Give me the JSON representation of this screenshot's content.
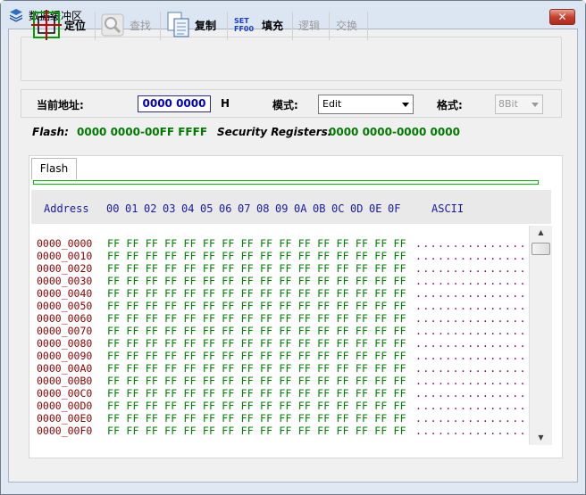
{
  "window": {
    "title": "数据缓冲区",
    "close_label": "✕"
  },
  "toolbar": {
    "items": [
      {
        "label": "定位",
        "icon": "crosshair-icon",
        "enabled": true
      },
      {
        "label": "查找",
        "icon": "magnifier-icon",
        "enabled": false
      },
      {
        "label": "复制",
        "icon": "copy-icon",
        "enabled": true
      },
      {
        "label": "填充",
        "icon": "set-ff-fill-icon",
        "enabled": true
      },
      {
        "label": "逻辑",
        "enabled": false
      },
      {
        "label": "交换",
        "enabled": false
      }
    ],
    "fill_icon_top": "SET",
    "fill_icon_bottom": "FF00"
  },
  "info": {
    "address_label": "当前地址:",
    "address_value": "0000 0000",
    "address_suffix": "H",
    "mode_label": "模式:",
    "mode_value": "Edit",
    "format_label": "格式:",
    "format_value": "8Bit"
  },
  "ranges": {
    "flash_label": "Flash:",
    "flash_range": "0000 0000-00FF FFFF",
    "security_label": "Security Registers:",
    "security_range": "0000 0000-0000 0000"
  },
  "tabs": [
    {
      "label": "Flash",
      "selected": true
    }
  ],
  "hex": {
    "address_header": "Address",
    "column_headers": [
      "00",
      "01",
      "02",
      "03",
      "04",
      "05",
      "06",
      "07",
      "08",
      "09",
      "0A",
      "0B",
      "0C",
      "0D",
      "0E",
      "0F"
    ],
    "ascii_header": "ASCII",
    "rows": [
      {
        "address": "0000_0000",
        "bytes": "FF FF FF FF FF FF FF FF FF FF FF FF FF FF FF FF",
        "ascii": "................"
      },
      {
        "address": "0000_0010",
        "bytes": "FF FF FF FF FF FF FF FF FF FF FF FF FF FF FF FF",
        "ascii": "................"
      },
      {
        "address": "0000_0020",
        "bytes": "FF FF FF FF FF FF FF FF FF FF FF FF FF FF FF FF",
        "ascii": "................"
      },
      {
        "address": "0000_0030",
        "bytes": "FF FF FF FF FF FF FF FF FF FF FF FF FF FF FF FF",
        "ascii": "................"
      },
      {
        "address": "0000_0040",
        "bytes": "FF FF FF FF FF FF FF FF FF FF FF FF FF FF FF FF",
        "ascii": "................"
      },
      {
        "address": "0000_0050",
        "bytes": "FF FF FF FF FF FF FF FF FF FF FF FF FF FF FF FF",
        "ascii": "................"
      },
      {
        "address": "0000_0060",
        "bytes": "FF FF FF FF FF FF FF FF FF FF FF FF FF FF FF FF",
        "ascii": "................"
      },
      {
        "address": "0000_0070",
        "bytes": "FF FF FF FF FF FF FF FF FF FF FF FF FF FF FF FF",
        "ascii": "................"
      },
      {
        "address": "0000_0080",
        "bytes": "FF FF FF FF FF FF FF FF FF FF FF FF FF FF FF FF",
        "ascii": "................"
      },
      {
        "address": "0000_0090",
        "bytes": "FF FF FF FF FF FF FF FF FF FF FF FF FF FF FF FF",
        "ascii": "................"
      },
      {
        "address": "0000_00A0",
        "bytes": "FF FF FF FF FF FF FF FF FF FF FF FF FF FF FF FF",
        "ascii": "................"
      },
      {
        "address": "0000_00B0",
        "bytes": "FF FF FF FF FF FF FF FF FF FF FF FF FF FF FF FF",
        "ascii": "................"
      },
      {
        "address": "0000_00C0",
        "bytes": "FF FF FF FF FF FF FF FF FF FF FF FF FF FF FF FF",
        "ascii": "................"
      },
      {
        "address": "0000_00D0",
        "bytes": "FF FF FF FF FF FF FF FF FF FF FF FF FF FF FF FF",
        "ascii": "................"
      },
      {
        "address": "0000_00E0",
        "bytes": "FF FF FF FF FF FF FF FF FF FF FF FF FF FF FF FF",
        "ascii": "................"
      },
      {
        "address": "0000_00F0",
        "bytes": "FF FF FF FF FF FF FF FF FF FF FF FF FF FF FF FF",
        "ascii": "................"
      }
    ]
  },
  "scrollbar": {
    "up": "▲",
    "down": "▼"
  }
}
